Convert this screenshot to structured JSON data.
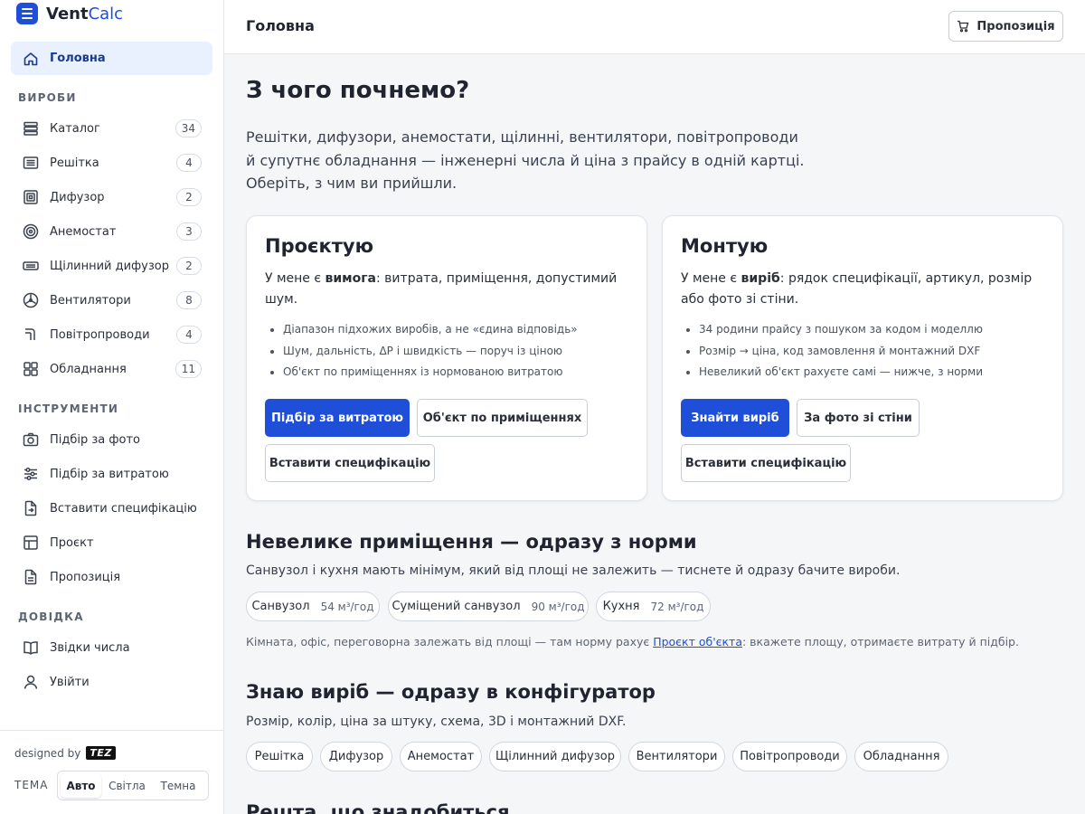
{
  "brand": {
    "name_bold": "Vent",
    "name_light": "Calc"
  },
  "sidebar": {
    "home": {
      "label": "Головна",
      "icon": "home-icon"
    },
    "sections": [
      {
        "title": "ВИРОБИ"
      },
      {
        "title": "ІНСТРУМЕНТИ"
      },
      {
        "title": "ДОВІДКА"
      }
    ],
    "products": [
      {
        "label": "Каталог",
        "count": "34",
        "icon": "catalog-icon"
      },
      {
        "label": "Решітка",
        "count": "4",
        "icon": "grille-icon"
      },
      {
        "label": "Дифузор",
        "count": "2",
        "icon": "diffuser-icon"
      },
      {
        "label": "Анемостат",
        "count": "3",
        "icon": "anemostat-icon"
      },
      {
        "label": "Щілинний дифузор",
        "count": "2",
        "icon": "slot-diffuser-icon"
      },
      {
        "label": "Вентилятори",
        "count": "8",
        "icon": "fan-icon"
      },
      {
        "label": "Повітропроводи",
        "count": "4",
        "icon": "duct-icon"
      },
      {
        "label": "Обладнання",
        "count": "11",
        "icon": "equipment-icon"
      }
    ],
    "tools": [
      {
        "label": "Підбір за фото",
        "icon": "camera-icon"
      },
      {
        "label": "Підбір за витратою",
        "icon": "sliders-icon"
      },
      {
        "label": "Вставити специфікацію",
        "icon": "file-import-icon"
      },
      {
        "label": "Проєкт",
        "icon": "layout-icon"
      },
      {
        "label": "Пропозиція",
        "icon": "document-icon"
      }
    ],
    "help": [
      {
        "label": "Звідки числа",
        "icon": "book-icon"
      },
      {
        "label": "Увійти",
        "icon": "user-icon"
      }
    ],
    "footer": {
      "designed_by": "designed by",
      "designer_logo": "TEZ",
      "theme_label": "ТЕМА",
      "theme_options": [
        "Авто",
        "Світла",
        "Темна"
      ],
      "theme_selected": "Авто"
    }
  },
  "topbar": {
    "title": "Головна",
    "offer_button": "Пропозиція",
    "offer_icon": "cart-icon"
  },
  "hero": {
    "title": "З чого почнемо?",
    "lead_lines": [
      "Решітки, дифузори, анемостати, щілинні, вентилятори, повітропроводи",
      "й супутнє обладнання — інженерні числа й ціна з прайсу в одній картці.",
      "Оберіть, з чим ви прийшли."
    ]
  },
  "cards": {
    "design": {
      "title": "Проєктую",
      "desc_prefix": "У мене є ",
      "desc_bold": "вимога",
      "desc_suffix": ": витрата, приміщення, допустимий шум.",
      "bullets": [
        "Діапазон підхожих виробів, а не «єдина відповідь»",
        "Шум, дальність, ΔP і швидкість — поруч із ціною",
        "Об'єкт по приміщеннях із нормованою витратою"
      ],
      "buttons": [
        "Підбір за витратою",
        "Об'єкт по приміщеннях",
        "Вставити специфікацію"
      ]
    },
    "install": {
      "title": "Монтую",
      "desc_prefix": "У мене є ",
      "desc_bold": "виріб",
      "desc_suffix": ": рядок специфікації, артикул, розмір або фото зі стіни.",
      "bullets": [
        "34 родини прайсу з пошуком за кодом і моделлю",
        "Розмір → ціна, код замовлення й монтажний DXF",
        "Невеликий об'єкт рахуєте самі — нижче, з норми"
      ],
      "buttons": [
        "Знайти виріб",
        "За фото зі стіни",
        "Вставити специфікацію"
      ]
    }
  },
  "small_room": {
    "title": "Невелике приміщення — одразу з норми",
    "subtitle": "Санвузол і кухня мають мінімум, який від площі не залежить — тиснете й одразу бачите вироби.",
    "chips": [
      {
        "label": "Санвузол",
        "value": "54 м³/год"
      },
      {
        "label": "Суміщений санвузол",
        "value": "90 м³/год"
      },
      {
        "label": "Кухня",
        "value": "72 м³/год"
      }
    ],
    "note_before": "Кімната, офіс, переговорна залежать від площі — там норму рахує ",
    "note_link": "Проєкт об'єкта",
    "note_after": ": вкажете площу, отримаєте витрату й підбір."
  },
  "know_product": {
    "title": "Знаю виріб — одразу в конфігуратор",
    "subtitle": "Розмір, колір, ціна за штуку, схема, 3D і монтажний DXF.",
    "chips": [
      "Решітка",
      "Дифузор",
      "Анемостат",
      "Щілинний дифузор",
      "Вентилятори",
      "Повітропроводи",
      "Обладнання"
    ]
  },
  "rest": {
    "title": "Решта, що знадобиться"
  }
}
